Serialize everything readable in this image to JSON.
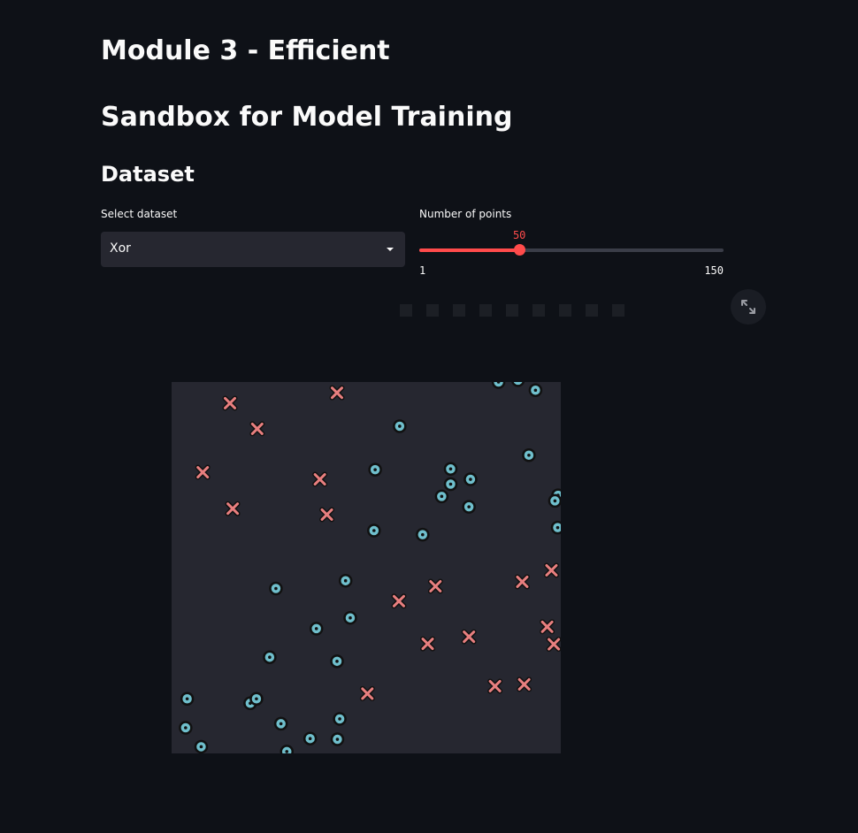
{
  "header": {
    "title": "Module 3 - Efficient",
    "subtitle": "Sandbox for Model Training",
    "section": "Dataset"
  },
  "controls": {
    "select_label": "Select dataset",
    "select_value": "Xor",
    "slider_label": "Number of points",
    "slider_value": "50",
    "slider_min": "1",
    "slider_max": "150",
    "slider_fraction": 0.329
  },
  "colors": {
    "background": "#0e1117",
    "plot_background": "#262730",
    "accent": "#ff4b4b",
    "class_circle": "#6fbfcc",
    "class_x": "#e87f7f"
  },
  "icons": {
    "toolbar": [
      "pan-icon",
      "zoom-icon",
      "box-select-icon",
      "lasso-icon",
      "zoom-in-icon",
      "zoom-out-icon",
      "autoscale-icon",
      "reset-icon",
      "plotly-logo-icon"
    ],
    "fullscreen": "fullscreen-icon"
  },
  "chart_data": {
    "type": "scatter",
    "xlim": [
      0,
      1
    ],
    "ylim": [
      0,
      1
    ],
    "grid": false,
    "series": [
      {
        "marker": "circle",
        "points": [
          [
            0.84,
            1.0
          ],
          [
            0.89,
            1.005
          ],
          [
            0.935,
            0.978
          ],
          [
            0.586,
            0.881
          ],
          [
            0.523,
            0.764
          ],
          [
            0.717,
            0.766
          ],
          [
            0.768,
            0.738
          ],
          [
            0.717,
            0.725
          ],
          [
            0.694,
            0.692
          ],
          [
            0.764,
            0.664
          ],
          [
            0.918,
            0.803
          ],
          [
            0.993,
            0.695
          ],
          [
            0.985,
            0.68
          ],
          [
            0.992,
            0.608
          ],
          [
            0.52,
            0.6
          ],
          [
            0.645,
            0.589
          ],
          [
            0.268,
            0.444
          ],
          [
            0.447,
            0.465
          ],
          [
            0.459,
            0.365
          ],
          [
            0.372,
            0.336
          ],
          [
            0.252,
            0.259
          ],
          [
            0.425,
            0.248
          ],
          [
            0.04,
            0.147
          ],
          [
            0.202,
            0.135
          ],
          [
            0.218,
            0.147
          ],
          [
            0.036,
            0.069
          ],
          [
            0.281,
            0.08
          ],
          [
            0.432,
            0.093
          ],
          [
            0.356,
            0.04
          ],
          [
            0.426,
            0.038
          ],
          [
            0.076,
            0.018
          ],
          [
            0.296,
            0.005
          ]
        ]
      },
      {
        "marker": "x",
        "points": [
          [
            0.15,
            0.943
          ],
          [
            0.425,
            0.971
          ],
          [
            0.22,
            0.874
          ],
          [
            0.08,
            0.757
          ],
          [
            0.381,
            0.738
          ],
          [
            0.157,
            0.659
          ],
          [
            0.399,
            0.643
          ],
          [
            0.976,
            0.493
          ],
          [
            0.901,
            0.462
          ],
          [
            0.678,
            0.45
          ],
          [
            0.584,
            0.41
          ],
          [
            0.965,
            0.341
          ],
          [
            0.982,
            0.294
          ],
          [
            0.764,
            0.314
          ],
          [
            0.658,
            0.295
          ],
          [
            0.906,
            0.186
          ],
          [
            0.831,
            0.181
          ],
          [
            0.503,
            0.161
          ]
        ]
      }
    ]
  }
}
